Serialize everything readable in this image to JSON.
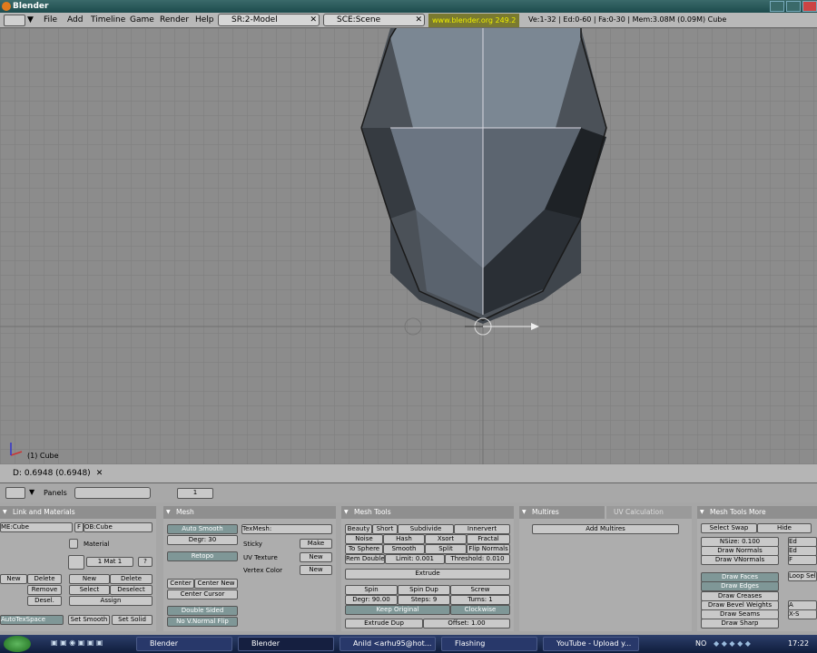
{
  "window": {
    "title": "Blender"
  },
  "menu": {
    "items": [
      "File",
      "Add",
      "Timeline",
      "Game",
      "Render",
      "Help"
    ],
    "screen": "SR:2-Model",
    "scene": "SCE:Scene",
    "url": "www.blender.org 249.2",
    "stats": "Ve:1-32 | Ed:0-60 | Fa:0-30 | Mem:3.08M (0.09M) Cube"
  },
  "viewport": {
    "object_label": "(1) Cube",
    "status": "D: 0.6948 (0.6948)"
  },
  "btnhdr": {
    "panels_label": "Panels",
    "frame": "1"
  },
  "link": {
    "title": "Link and Materials",
    "me": "ME:Cube",
    "f": "F",
    "ob": "OB:Cube",
    "material": "Material",
    "mat": "1 Mat 1",
    "q": "?",
    "new": "New",
    "delete": "Delete",
    "remove": "Remove",
    "select": "Select",
    "deselect": "Deselect",
    "desel": "Desel.",
    "assign": "Assign",
    "autotex": "AutoTexSpace",
    "set_smooth": "Set Smooth",
    "set_solid": "Set Solid"
  },
  "mesh": {
    "title": "Mesh",
    "auto_smooth": "Auto Smooth",
    "degr": "Degr: 30",
    "retopo": "Retopo",
    "center": "Center",
    "center_new": "Center New",
    "center_cursor": "Center Cursor",
    "double_sided": "Double Sided",
    "no_vnormal": "No V.Normal Flip",
    "texmesh": "TexMesh:",
    "sticky": "Sticky",
    "make": "Make",
    "uvtex": "UV Texture",
    "vcol": "Vertex Color",
    "new": "New"
  },
  "tools": {
    "title": "Mesh Tools",
    "beauty": "Beauty",
    "short": "Short",
    "subdivide": "Subdivide",
    "innervert": "Innervert",
    "noise": "Noise",
    "hash": "Hash",
    "xsort": "Xsort",
    "fractal": "Fractal",
    "tosphere": "To Sphere",
    "smooth": "Smooth",
    "split": "Split",
    "flip": "Flip Normals",
    "remdbl": "Rem Doubles",
    "limit": "Limit: 0.001",
    "threshold": "Threshold: 0.010",
    "extrude": "Extrude",
    "spin": "Spin",
    "spindup": "Spin Dup",
    "screw": "Screw",
    "degr": "Degr: 90.00",
    "steps": "Steps: 9",
    "turns": "Turns: 1",
    "keep": "Keep Original",
    "clockwise": "Clockwise",
    "extdup": "Extrude Dup",
    "offset": "Offset: 1.00"
  },
  "multires": {
    "tab1": "Multires",
    "tab2": "UV Calculation",
    "add": "Add Multires"
  },
  "more": {
    "title": "Mesh Tools More",
    "select_swap": "Select Swap",
    "hide": "Hide",
    "nsize": "NSize: 0.100",
    "draw_normals": "Draw Normals",
    "draw_vnormals": "Draw VNormals",
    "draw_faces": "Draw Faces",
    "draw_edges": "Draw Edges",
    "draw_creases": "Draw Creases",
    "draw_bevel": "Draw Bevel Weights",
    "draw_seams": "Draw Seams",
    "draw_sharp": "Draw Sharp",
    "loop": "Loop Sel",
    "ed1": "Ed",
    "ed2": "Ed",
    "f": "F",
    "a": "A",
    "xs": "X-S"
  },
  "taskbar": {
    "items": [
      "Blender",
      "Blender",
      "Anild <arhu95@hot...",
      "Flashing",
      "YouTube - Upload y..."
    ],
    "lang": "NO",
    "clock": "17:22"
  }
}
